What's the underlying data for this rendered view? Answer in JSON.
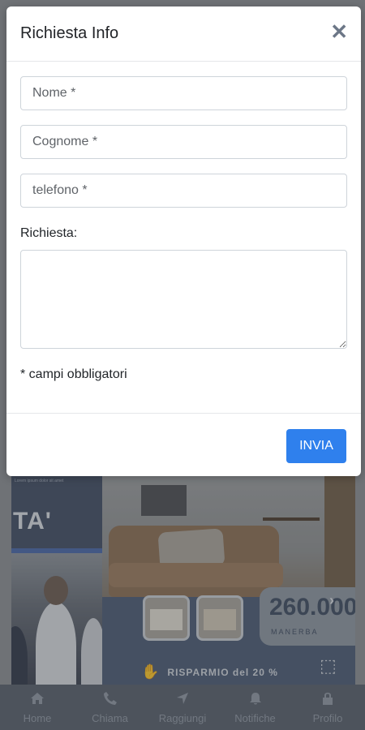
{
  "modal": {
    "title": "Richiesta Info",
    "close_icon": "close-icon",
    "fields": {
      "nome_placeholder": "Nome *",
      "cognome_placeholder": "Cognome *",
      "telefono_placeholder": "telefono *",
      "richiesta_label": "Richiesta:"
    },
    "note": "* campi obbligatori",
    "submit_label": "INVIA"
  },
  "background": {
    "banner_text": "TA'",
    "price": "260.000",
    "location": "MANERBA",
    "savings": "RISPARMIO del 20 %"
  },
  "tabbar": {
    "items": [
      {
        "label": "Home",
        "icon": "home-icon"
      },
      {
        "label": "Chiama",
        "icon": "phone-icon"
      },
      {
        "label": "Raggiungi",
        "icon": "navigation-icon"
      },
      {
        "label": "Notifiche",
        "icon": "bell-icon"
      },
      {
        "label": "Profilo",
        "icon": "lock-icon"
      }
    ]
  },
  "colors": {
    "accent": "#2f80ed",
    "tabbar_bg": "#565f6b"
  }
}
